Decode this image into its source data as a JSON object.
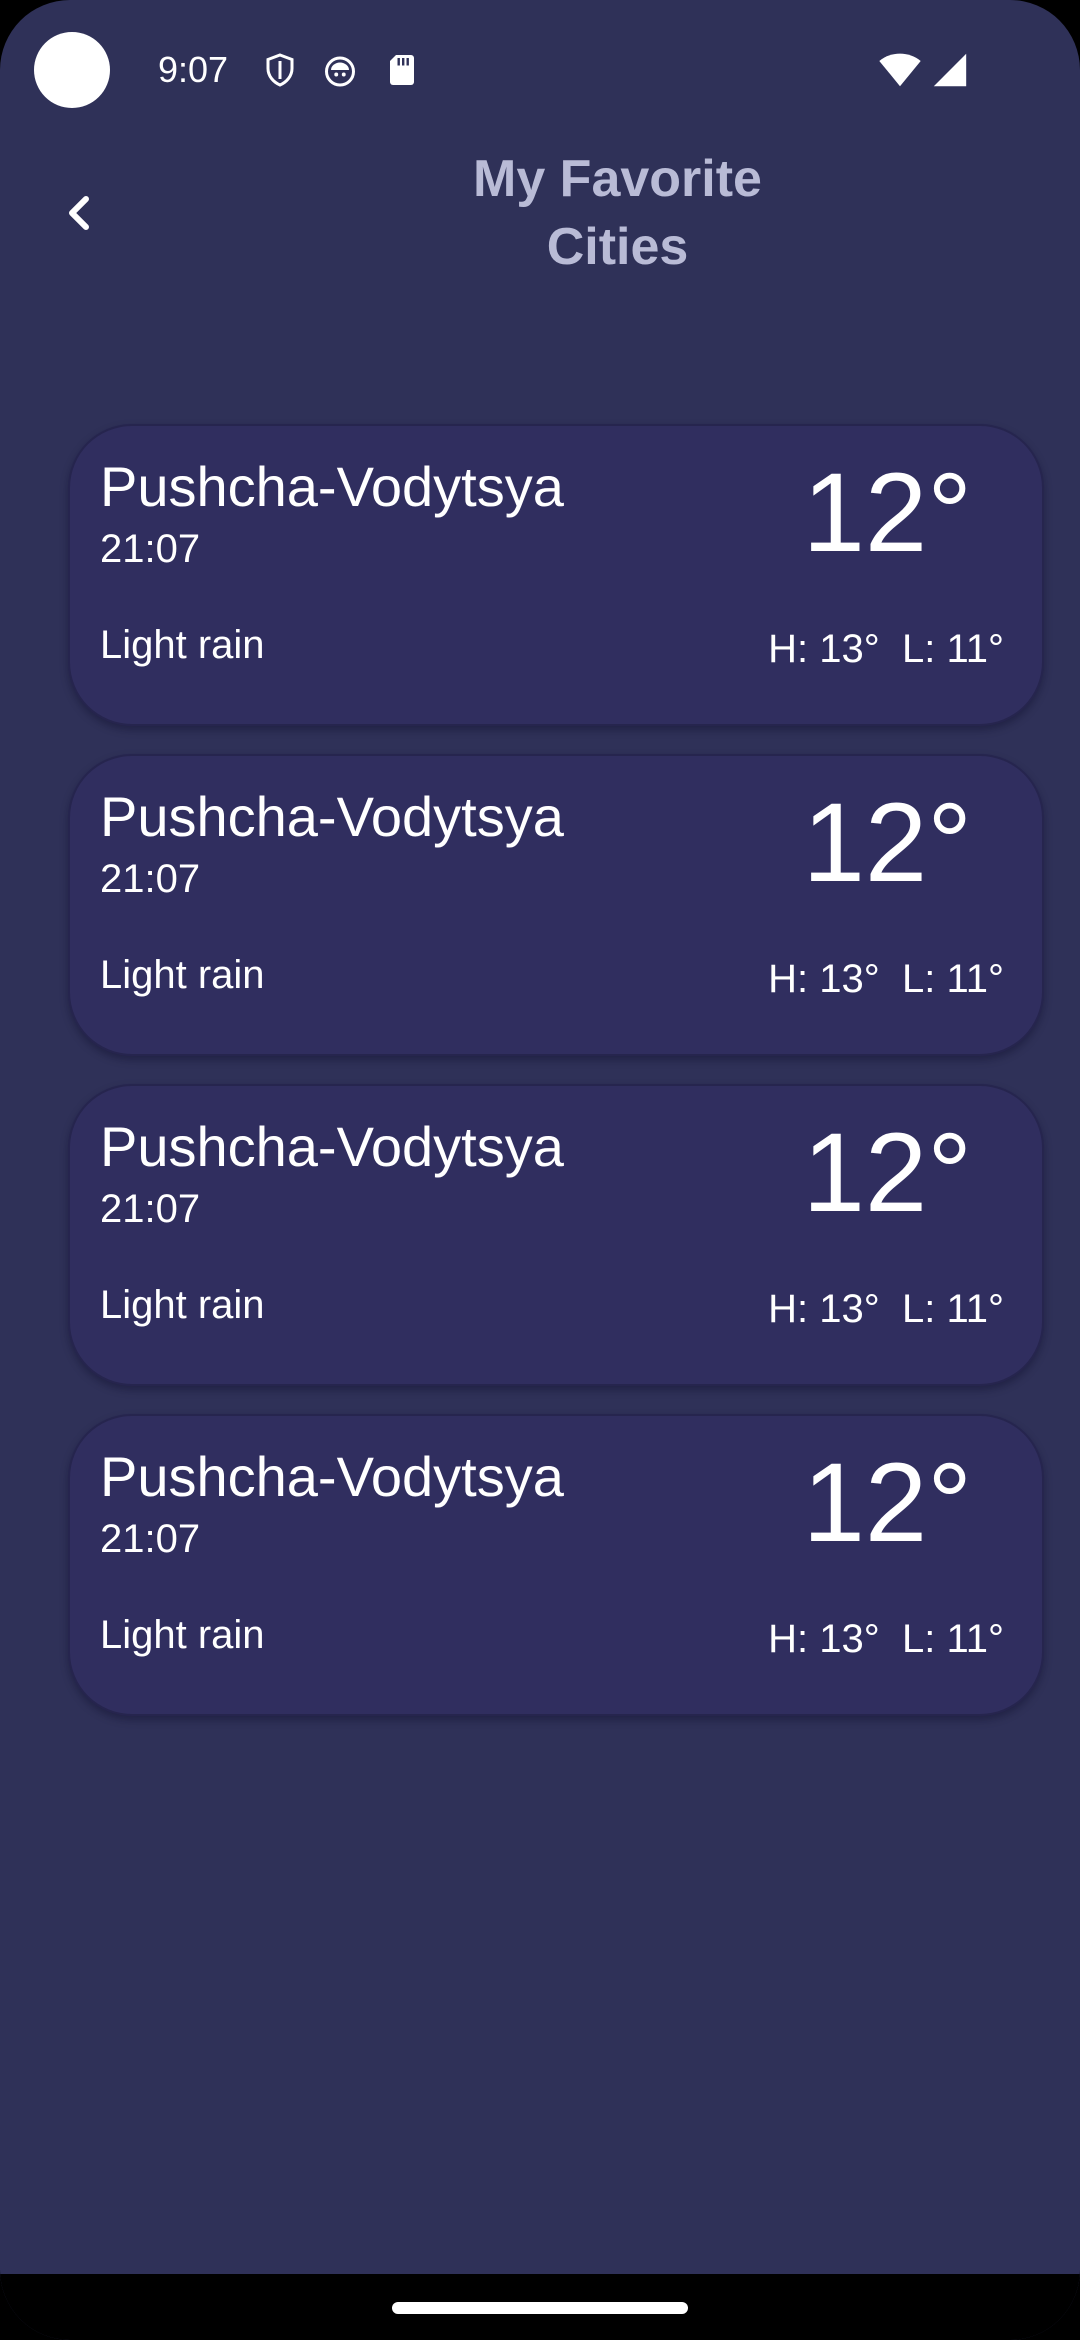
{
  "status_bar": {
    "time": "9:07",
    "icons_left": [
      "shield-icon",
      "android-face-icon",
      "sd-card-icon"
    ],
    "icons_right": [
      "wifi-icon",
      "cellular-signal-icon"
    ]
  },
  "header": {
    "back_icon": "chevron-left-icon",
    "title": "My Favorite\nCities"
  },
  "cities": [
    {
      "name": "Pushcha-Vodytsya",
      "time": "21:07",
      "condition": "Light rain",
      "temp": "12°",
      "high_low": "H: 13°  L: 11°"
    },
    {
      "name": "Pushcha-Vodytsya",
      "time": "21:07",
      "condition": "Light rain",
      "temp": "12°",
      "high_low": "H: 13°  L: 11°"
    },
    {
      "name": "Pushcha-Vodytsya",
      "time": "21:07",
      "condition": "Light rain",
      "temp": "12°",
      "high_low": "H: 13°  L: 11°"
    },
    {
      "name": "Pushcha-Vodytsya",
      "time": "21:07",
      "condition": "Light rain",
      "temp": "12°",
      "high_low": "H: 13°  L: 11°"
    }
  ],
  "colors": {
    "background": "#2f3158",
    "card": "#302e5f",
    "title": "#b9bbd6",
    "text": "#ffffff"
  }
}
